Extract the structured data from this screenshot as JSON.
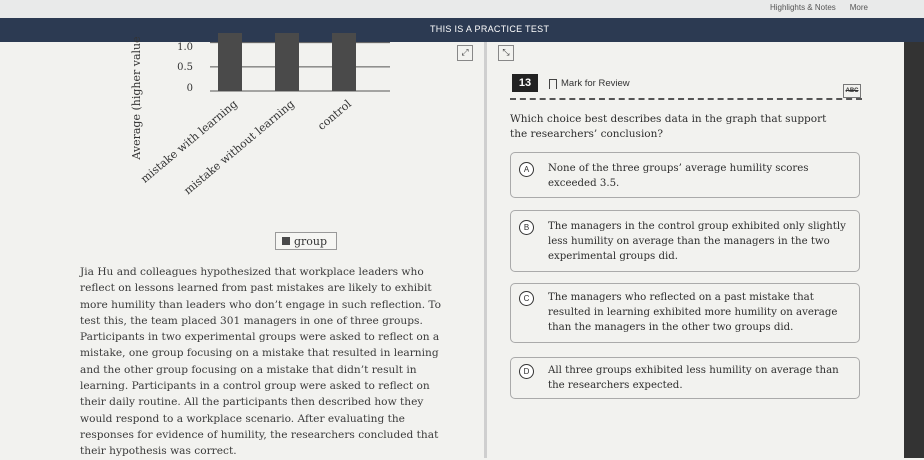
{
  "topbar": {
    "links": [
      "Highlights & Notes",
      "More"
    ]
  },
  "banner": {
    "label": "THIS IS A PRACTICE TEST"
  },
  "chart_data": {
    "type": "bar",
    "ylabel": "Average (higher value",
    "yticks": [
      "1.0",
      "0.5",
      "0"
    ],
    "ylim": [
      0,
      1.2
    ],
    "categories": [
      "mistake with learning",
      "mistake without learning",
      "control"
    ],
    "values": [
      1.2,
      1.2,
      1.2
    ],
    "legend": "group",
    "colors": {
      "bar": "#4a4a4a",
      "grid": "#555555"
    }
  },
  "passage": {
    "text": "Jia Hu and colleagues hypothesized that workplace leaders who reflect on lessons learned from past mistakes are likely to exhibit more humility than leaders who don’t engage in such reflection. To test this, the team placed 301 managers in one of three groups. Participants in two experimental groups were asked to reflect on a mistake, one group focusing on a mistake that resulted in learning and the other group focusing on a mistake that didn’t result in learning. Participants in a control group were asked to reflect on their daily routine. All the participants then described how they would respond to a workplace scenario. After evaluating the responses for evidence of humility, the researchers concluded that their hypothesis was correct."
  },
  "question": {
    "number": "13",
    "mark_label": "Mark for Review",
    "abc": "ABC",
    "prompt": "Which choice best describes data in the graph that support the researchers’ conclusion?",
    "options": [
      {
        "letter": "A",
        "text": "None of the three groups’ average humility scores exceeded 3.5."
      },
      {
        "letter": "B",
        "text": "The managers in the control group exhibited only slightly less humility on average than the managers in the two experimental groups did."
      },
      {
        "letter": "C",
        "text": "The managers who reflected on a past mistake that resulted in learning exhibited more humility on average than the managers in the other two groups did."
      },
      {
        "letter": "D",
        "text": "All three groups exhibited less humility on average than the researchers expected."
      }
    ]
  }
}
